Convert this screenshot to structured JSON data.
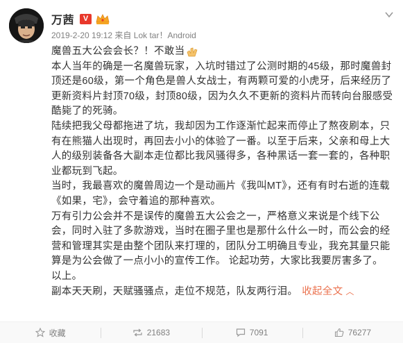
{
  "post": {
    "author": "万茜",
    "vip_badge": "V",
    "meta_time": "2019-2-20 19:12",
    "meta_source_prefix": "来自",
    "meta_source": "Lok tar！Android",
    "title": "魔兽五大公会会长？！不敢当",
    "paragraphs": [
      "本人当年的确是一名魔兽玩家，入坑时错过了公测时期的45级，那时魔兽封顶还是60级，第一个角色是兽人女战士，有两颗可爱的小虎牙，后来经历了更新资料片封顶70级，封顶80级，因为久久不更新的资料片而转向台服感受酷毙了的死骑。",
      "陆续把我父母都拖进了坑，我却因为工作逐渐忙起来而停止了熬夜刷本，只有在熊猫人出现时，再回去小小的体验了一番。以至于后来，父亲和母上大人的级别装备各大副本走位都比我风骚得多，各种黑话一套一套的，各种职业都玩到飞起。",
      "当时，我最喜欢的魔兽周边一个是动画片《我叫MT》，还有有时右逝的连载《如果，宅》，会守着追的那种喜欢。",
      "万有引力公会并不是误传的魔兽五大公会之一，严格意义来说是个线下公会，同时入驻了多款游戏，当时在圈子里也是那什么什么一时，而公会的经营和管理其实是由整个团队来打理的，团队分工明确且专业，我充其量只能算是为公会做了一点小小的宣传工作。 论起功劳，大家比我要厉害多了。",
      "以上。"
    ],
    "last_line": "副本天天刷，天赋骚骚点，走位不规范，队友两行泪。",
    "collapse_label": "收起全文",
    "collapse_arrow": "︿"
  },
  "actions": {
    "favorite": "收藏",
    "repost": "21683",
    "comment": "7091",
    "like": "76277"
  },
  "colors": {
    "accent": "#eb7350",
    "vip": "#e8382b",
    "text": "#333333",
    "meta": "#808080"
  }
}
